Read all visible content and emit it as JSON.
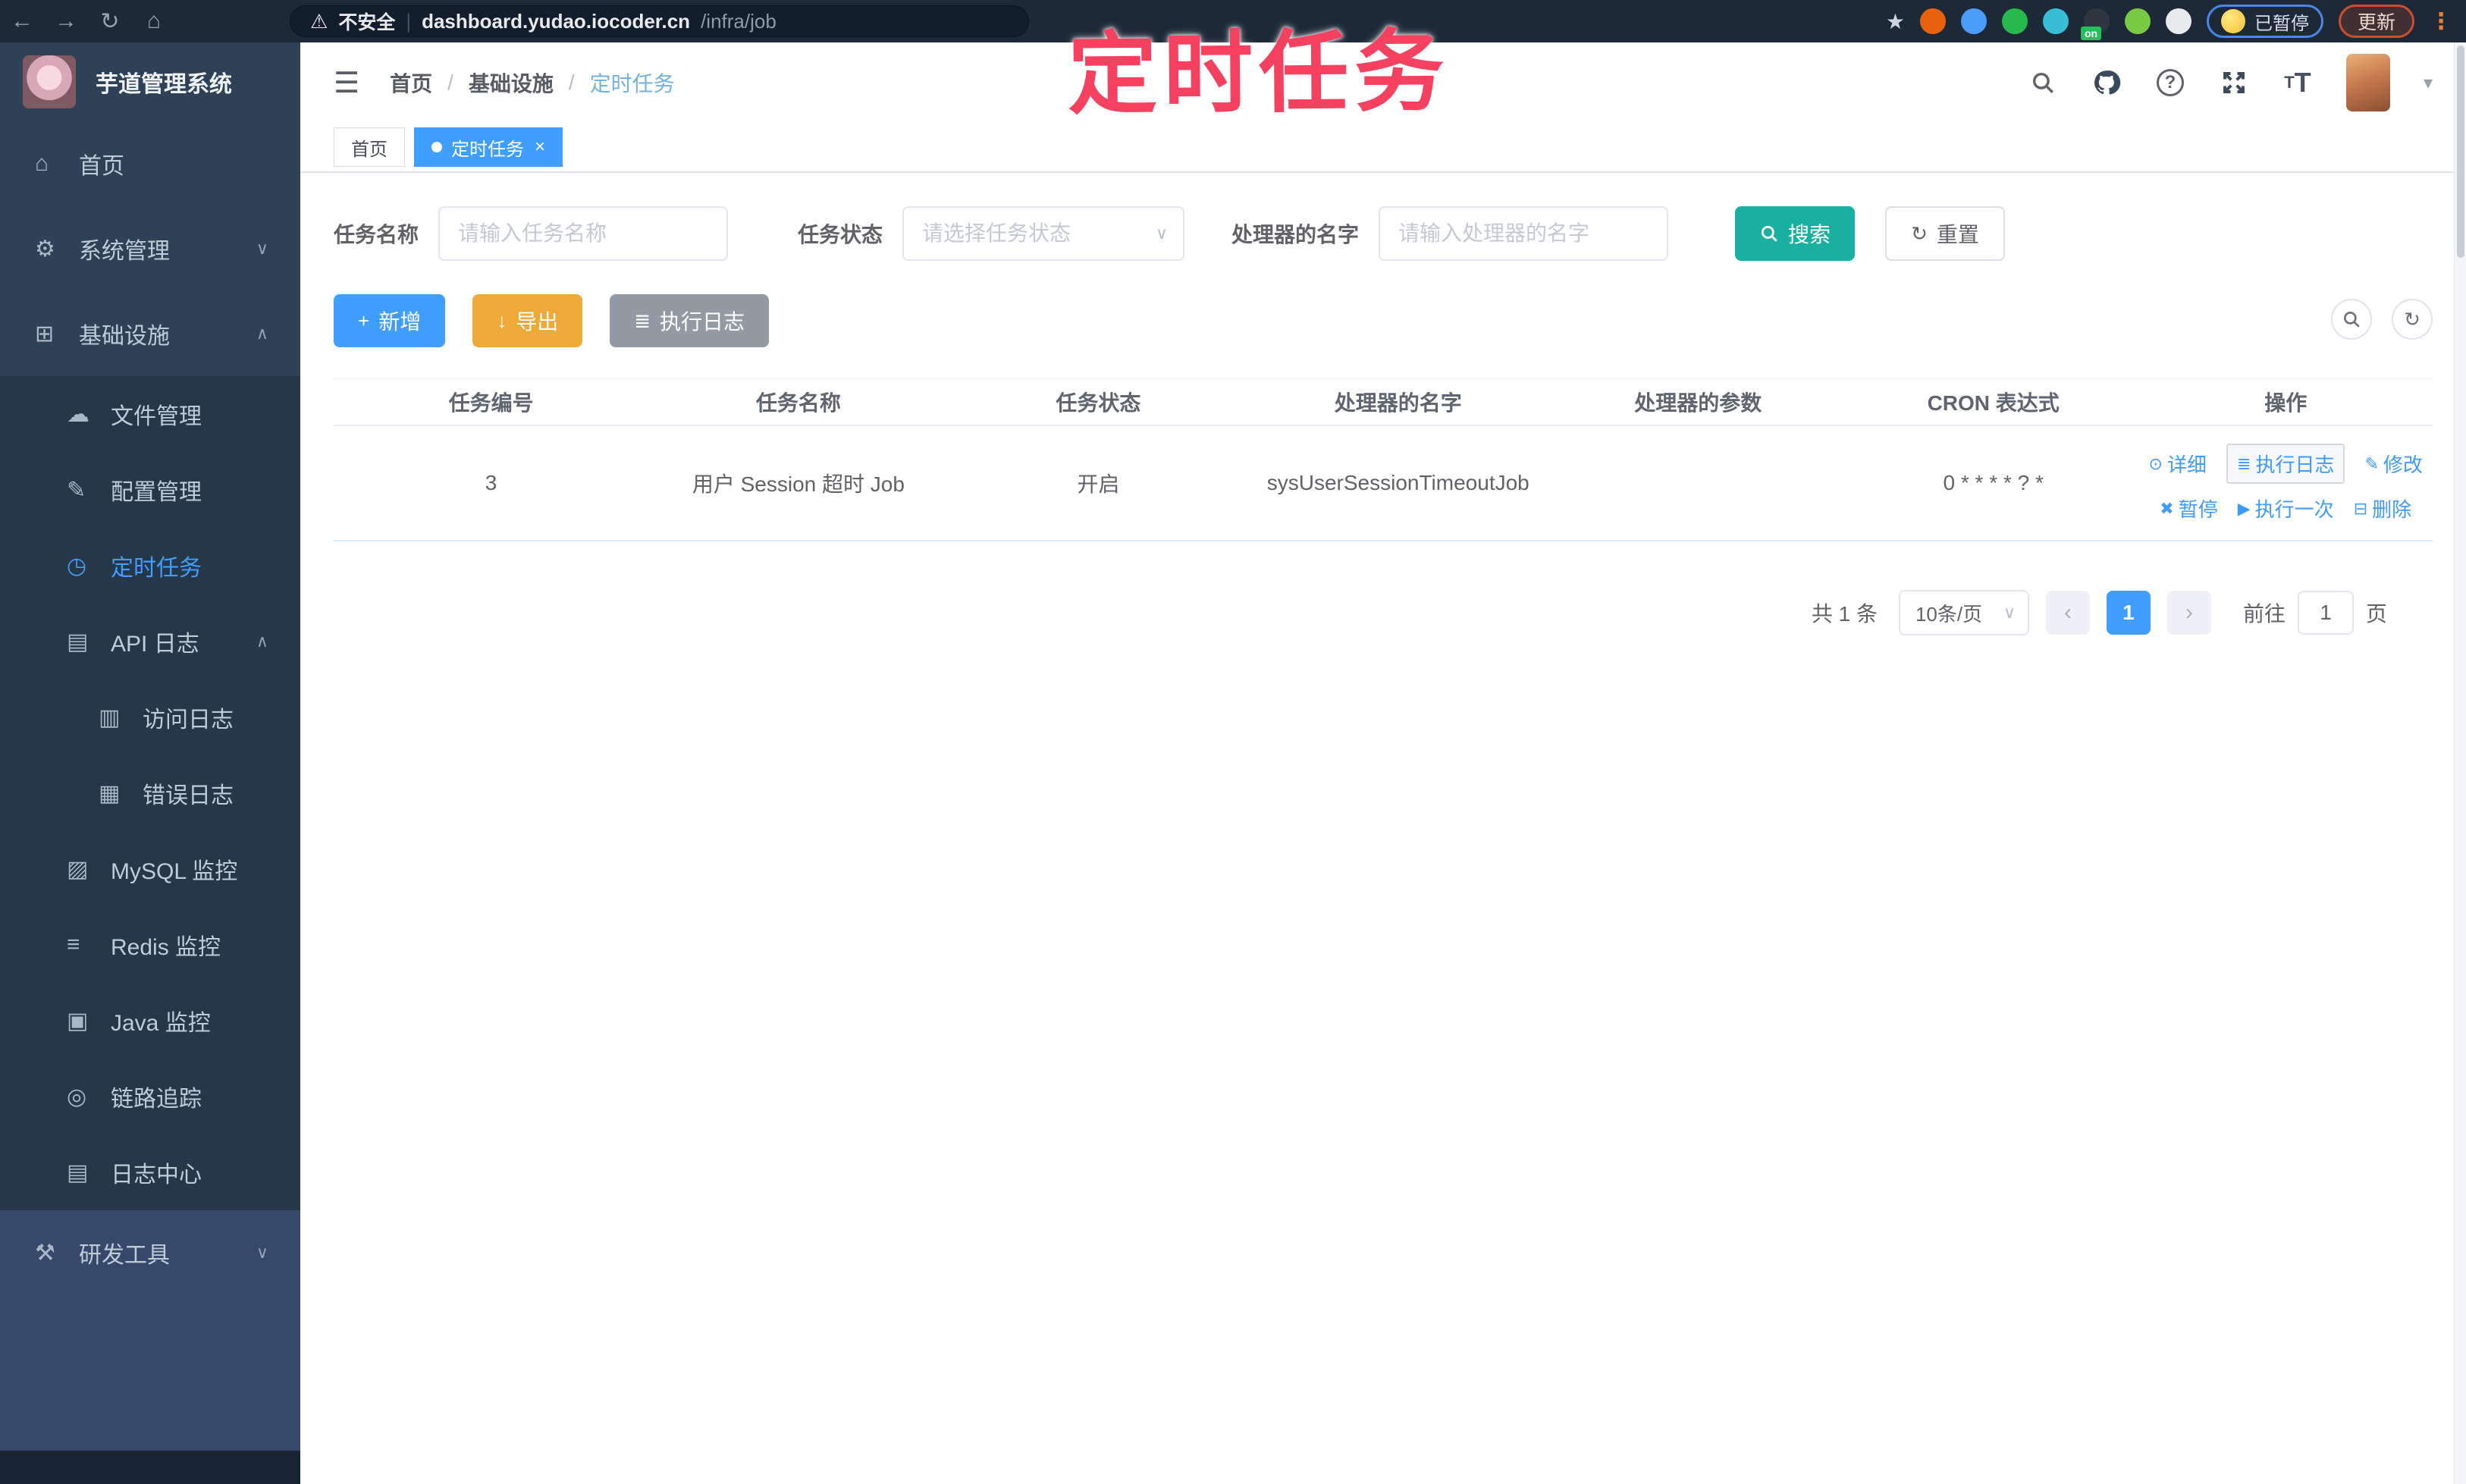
{
  "glyphs": {
    "back": "←",
    "forward": "→",
    "reload": "↻",
    "home": "⌂",
    "warning": "⚠",
    "divider": "|",
    "star": "★",
    "menu_dots": "⋮",
    "hamburger": "☰",
    "caret": "▾",
    "chevron_down": "∨",
    "chevron_up": "∧",
    "plus": "+",
    "download": "↓",
    "list": "≣",
    "refresh": "↻",
    "prev": "‹",
    "next": "›",
    "question": "?",
    "fontsize": "T"
  },
  "browser": {
    "security_warning": "不安全",
    "url_host": "dashboard.yudao.iocoder.cn",
    "url_path": "/infra/job",
    "extensions": [
      {
        "name": "extension-icon",
        "color": "#e8610c"
      },
      {
        "name": "extension-icon",
        "color": "#4a9df8"
      },
      {
        "name": "extension-icon",
        "color": "#27b84e"
      },
      {
        "name": "extension-icon",
        "color": "#38bdd6"
      },
      {
        "name": "extension-icon",
        "color": "#2f3640",
        "badge": "on"
      },
      {
        "name": "extension-icon",
        "color": "#7ac943"
      },
      {
        "name": "extension-icon",
        "color": "#e8eaed"
      }
    ],
    "paused_badge": "已暂停",
    "update_button": "更新"
  },
  "annotation": {
    "text": "定时任务",
    "color": "#f4415f"
  },
  "sidebar": {
    "app_title": "芋道管理系统",
    "items": [
      {
        "icon": "⌂",
        "label": "首页",
        "cls": "top"
      },
      {
        "icon": "⚙",
        "label": "系统管理",
        "cls": "top",
        "chevron": "∨"
      },
      {
        "icon": "⊞",
        "label": "基础设施",
        "cls": "top",
        "chevron": "∧"
      },
      {
        "icon": "☁",
        "label": "文件管理",
        "cls": "sub"
      },
      {
        "icon": "✎",
        "label": "配置管理",
        "cls": "sub"
      },
      {
        "icon": "◷",
        "label": "定时任务",
        "cls": "sub active"
      },
      {
        "icon": "▤",
        "label": "API 日志",
        "cls": "sub",
        "chevron": "∧"
      },
      {
        "icon": "▥",
        "label": "访问日志",
        "cls": "sub2"
      },
      {
        "icon": "▦",
        "label": "错误日志",
        "cls": "sub2"
      },
      {
        "icon": "▨",
        "label": "MySQL 监控",
        "cls": "sub"
      },
      {
        "icon": "≡",
        "label": "Redis 监控",
        "cls": "sub"
      },
      {
        "icon": "▣",
        "label": "Java 监控",
        "cls": "sub"
      },
      {
        "icon": "◎",
        "label": "链路追踪",
        "cls": "sub"
      },
      {
        "icon": "▤",
        "label": "日志中心",
        "cls": "sub"
      },
      {
        "icon": "⚒",
        "label": "研发工具",
        "cls": "tools",
        "chevron": "∨"
      }
    ]
  },
  "header": {
    "breadcrumb": {
      "0": "首页",
      "1": "基础设施",
      "2": "定时任务",
      "separator": "/"
    },
    "tabs": {
      "0": {
        "label": "首页"
      },
      "1": {
        "label": "定时任务",
        "close": "×"
      }
    }
  },
  "filters": {
    "name_label": "任务名称",
    "name_placeholder": "请输入任务名称",
    "status_label": "任务状态",
    "status_placeholder": "请选择任务状态",
    "handler_label": "处理器的名字",
    "handler_placeholder": "请输入处理器的名字",
    "search_button": "搜索",
    "reset_button": "重置"
  },
  "toolbar": {
    "add_label": "新增",
    "export_label": "导出",
    "exec_log_label": "执行日志"
  },
  "table": {
    "headers": [
      {
        "text": "任务编号"
      },
      {
        "text": "任务名称"
      },
      {
        "text": "任务状态"
      },
      {
        "text": "处理器的名字"
      },
      {
        "text": "处理器的参数"
      },
      {
        "text": "CRON 表达式"
      },
      {
        "text": "操作"
      }
    ],
    "row": {
      "id": "3",
      "name": "用户 Session 超时 Job",
      "status": "开启",
      "handler": "sysUserSessionTimeoutJob",
      "params": "",
      "cron": "0 * * * * ? *",
      "actions_line1": [
        {
          "icon": "⊙",
          "label": "详细",
          "cls": ""
        },
        {
          "icon": "≣",
          "label": "执行日志",
          "cls": "boxed"
        },
        {
          "icon": "✎",
          "label": "修改",
          "cls": ""
        }
      ],
      "actions_line2": [
        {
          "icon": "✖",
          "label": "暂停",
          "cls": ""
        },
        {
          "icon": "▶",
          "label": "执行一次",
          "cls": ""
        },
        {
          "icon": "⊟",
          "label": "删除",
          "cls": ""
        }
      ]
    }
  },
  "pagination": {
    "total": "共 1 条",
    "page_size": "10条/页",
    "current_page": "1",
    "goto_prefix": "前往",
    "goto_value": "1",
    "goto_suffix": "页"
  },
  "colors": {
    "accent": "#409eff",
    "search_teal": "#1ab0a0",
    "export_orange": "#efa937",
    "info_gray": "#939aa3",
    "annotation_pink": "#f4415f",
    "sidebar_bg": "#2e4156"
  }
}
